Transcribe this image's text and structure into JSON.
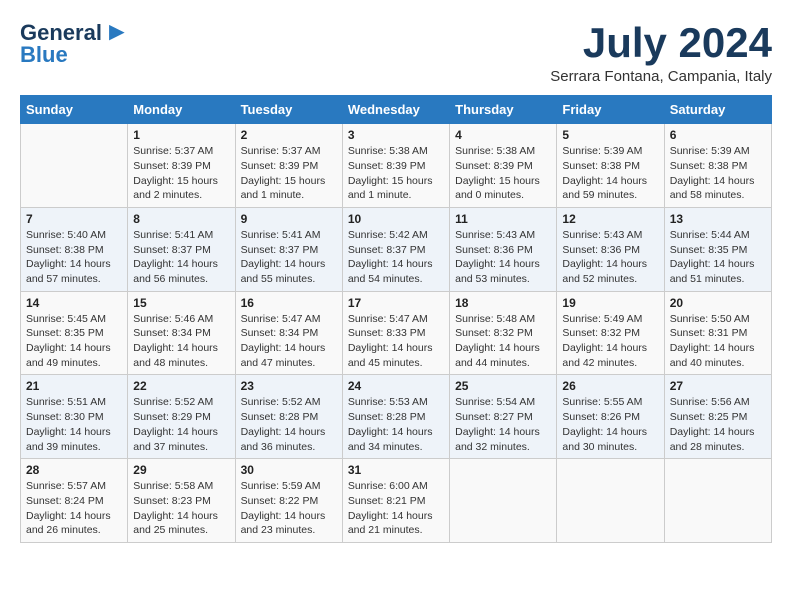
{
  "header": {
    "logo_line1": "General",
    "logo_line2": "Blue",
    "month_title": "July 2024",
    "subtitle": "Serrara Fontana, Campania, Italy"
  },
  "days_of_week": [
    "Sunday",
    "Monday",
    "Tuesday",
    "Wednesday",
    "Thursday",
    "Friday",
    "Saturday"
  ],
  "weeks": [
    [
      {
        "day": "",
        "info": ""
      },
      {
        "day": "1",
        "info": "Sunrise: 5:37 AM\nSunset: 8:39 PM\nDaylight: 15 hours\nand 2 minutes."
      },
      {
        "day": "2",
        "info": "Sunrise: 5:37 AM\nSunset: 8:39 PM\nDaylight: 15 hours\nand 1 minute."
      },
      {
        "day": "3",
        "info": "Sunrise: 5:38 AM\nSunset: 8:39 PM\nDaylight: 15 hours\nand 1 minute."
      },
      {
        "day": "4",
        "info": "Sunrise: 5:38 AM\nSunset: 8:39 PM\nDaylight: 15 hours\nand 0 minutes."
      },
      {
        "day": "5",
        "info": "Sunrise: 5:39 AM\nSunset: 8:38 PM\nDaylight: 14 hours\nand 59 minutes."
      },
      {
        "day": "6",
        "info": "Sunrise: 5:39 AM\nSunset: 8:38 PM\nDaylight: 14 hours\nand 58 minutes."
      }
    ],
    [
      {
        "day": "7",
        "info": "Sunrise: 5:40 AM\nSunset: 8:38 PM\nDaylight: 14 hours\nand 57 minutes."
      },
      {
        "day": "8",
        "info": "Sunrise: 5:41 AM\nSunset: 8:37 PM\nDaylight: 14 hours\nand 56 minutes."
      },
      {
        "day": "9",
        "info": "Sunrise: 5:41 AM\nSunset: 8:37 PM\nDaylight: 14 hours\nand 55 minutes."
      },
      {
        "day": "10",
        "info": "Sunrise: 5:42 AM\nSunset: 8:37 PM\nDaylight: 14 hours\nand 54 minutes."
      },
      {
        "day": "11",
        "info": "Sunrise: 5:43 AM\nSunset: 8:36 PM\nDaylight: 14 hours\nand 53 minutes."
      },
      {
        "day": "12",
        "info": "Sunrise: 5:43 AM\nSunset: 8:36 PM\nDaylight: 14 hours\nand 52 minutes."
      },
      {
        "day": "13",
        "info": "Sunrise: 5:44 AM\nSunset: 8:35 PM\nDaylight: 14 hours\nand 51 minutes."
      }
    ],
    [
      {
        "day": "14",
        "info": "Sunrise: 5:45 AM\nSunset: 8:35 PM\nDaylight: 14 hours\nand 49 minutes."
      },
      {
        "day": "15",
        "info": "Sunrise: 5:46 AM\nSunset: 8:34 PM\nDaylight: 14 hours\nand 48 minutes."
      },
      {
        "day": "16",
        "info": "Sunrise: 5:47 AM\nSunset: 8:34 PM\nDaylight: 14 hours\nand 47 minutes."
      },
      {
        "day": "17",
        "info": "Sunrise: 5:47 AM\nSunset: 8:33 PM\nDaylight: 14 hours\nand 45 minutes."
      },
      {
        "day": "18",
        "info": "Sunrise: 5:48 AM\nSunset: 8:32 PM\nDaylight: 14 hours\nand 44 minutes."
      },
      {
        "day": "19",
        "info": "Sunrise: 5:49 AM\nSunset: 8:32 PM\nDaylight: 14 hours\nand 42 minutes."
      },
      {
        "day": "20",
        "info": "Sunrise: 5:50 AM\nSunset: 8:31 PM\nDaylight: 14 hours\nand 40 minutes."
      }
    ],
    [
      {
        "day": "21",
        "info": "Sunrise: 5:51 AM\nSunset: 8:30 PM\nDaylight: 14 hours\nand 39 minutes."
      },
      {
        "day": "22",
        "info": "Sunrise: 5:52 AM\nSunset: 8:29 PM\nDaylight: 14 hours\nand 37 minutes."
      },
      {
        "day": "23",
        "info": "Sunrise: 5:52 AM\nSunset: 8:28 PM\nDaylight: 14 hours\nand 36 minutes."
      },
      {
        "day": "24",
        "info": "Sunrise: 5:53 AM\nSunset: 8:28 PM\nDaylight: 14 hours\nand 34 minutes."
      },
      {
        "day": "25",
        "info": "Sunrise: 5:54 AM\nSunset: 8:27 PM\nDaylight: 14 hours\nand 32 minutes."
      },
      {
        "day": "26",
        "info": "Sunrise: 5:55 AM\nSunset: 8:26 PM\nDaylight: 14 hours\nand 30 minutes."
      },
      {
        "day": "27",
        "info": "Sunrise: 5:56 AM\nSunset: 8:25 PM\nDaylight: 14 hours\nand 28 minutes."
      }
    ],
    [
      {
        "day": "28",
        "info": "Sunrise: 5:57 AM\nSunset: 8:24 PM\nDaylight: 14 hours\nand 26 minutes."
      },
      {
        "day": "29",
        "info": "Sunrise: 5:58 AM\nSunset: 8:23 PM\nDaylight: 14 hours\nand 25 minutes."
      },
      {
        "day": "30",
        "info": "Sunrise: 5:59 AM\nSunset: 8:22 PM\nDaylight: 14 hours\nand 23 minutes."
      },
      {
        "day": "31",
        "info": "Sunrise: 6:00 AM\nSunset: 8:21 PM\nDaylight: 14 hours\nand 21 minutes."
      },
      {
        "day": "",
        "info": ""
      },
      {
        "day": "",
        "info": ""
      },
      {
        "day": "",
        "info": ""
      }
    ]
  ]
}
